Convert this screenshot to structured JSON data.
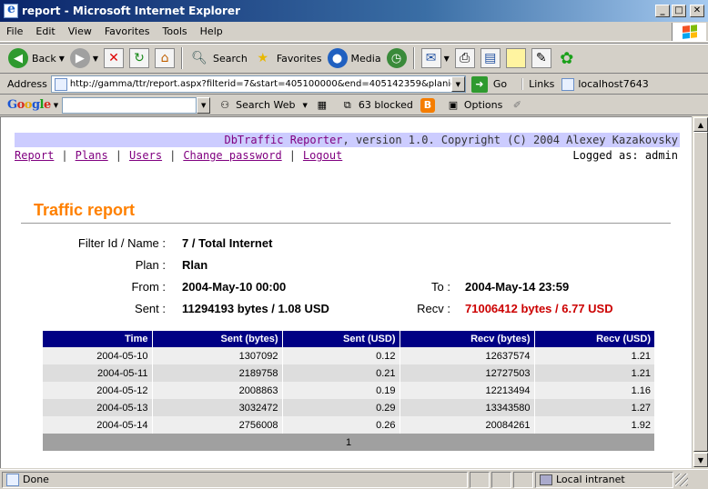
{
  "window": {
    "title": "report - Microsoft Internet Explorer",
    "min": "_",
    "max": "□",
    "close": "✕"
  },
  "menu": [
    "File",
    "Edit",
    "View",
    "Favorites",
    "Tools",
    "Help"
  ],
  "toolbar": {
    "back": "Back",
    "search": "Search",
    "favorites": "Favorites",
    "media": "Media"
  },
  "address": {
    "label": "Address",
    "url": "http://gamma/ttr/report.aspx?filterid=7&start=405100000&end=405142359&planid=9",
    "go": "Go",
    "links_label": "Links",
    "link_item": "localhost7643"
  },
  "google": {
    "search_web": "Search Web",
    "blocked": "63 blocked",
    "options": "Options"
  },
  "page": {
    "brand": "DbTraffic Reporter",
    "header_rest": ", version 1.0. Copyright (C) 2004 Alexey Kazakovsky",
    "nav": {
      "report": "Report",
      "plans": "Plans",
      "users": "Users",
      "change_password": "Change password",
      "logout": "Logout",
      "sep": "|",
      "logged_as": "Logged as: admin"
    },
    "title": "Traffic report",
    "info": {
      "filter_label": "Filter Id / Name :",
      "filter_value": "7 / Total Internet",
      "plan_label": "Plan :",
      "plan_value": "Rlan",
      "from_label": "From :",
      "from_value": "2004-May-10 00:00",
      "to_label": "To :",
      "to_value": "2004-May-14 23:59",
      "sent_label": "Sent :",
      "sent_value": "11294193 bytes / 1.08 USD",
      "recv_label": "Recv :",
      "recv_value": "71006412 bytes / 6.77 USD"
    },
    "table": {
      "headers": [
        "Time",
        "Sent (bytes)",
        "Sent (USD)",
        "Recv (bytes)",
        "Recv (USD)"
      ],
      "rows": [
        [
          "2004-05-10",
          "1307092",
          "0.12",
          "12637574",
          "1.21"
        ],
        [
          "2004-05-11",
          "2189758",
          "0.21",
          "12727503",
          "1.21"
        ],
        [
          "2004-05-12",
          "2008863",
          "0.19",
          "12213494",
          "1.16"
        ],
        [
          "2004-05-13",
          "3032472",
          "0.29",
          "13343580",
          "1.27"
        ],
        [
          "2004-05-14",
          "2756008",
          "0.26",
          "20084261",
          "1.92"
        ]
      ],
      "pager": "1"
    }
  },
  "status": {
    "text": "Done",
    "zone": "Local intranet"
  },
  "colors": {
    "title_accent": "#ff8000",
    "header_band": "#ccccff",
    "table_header": "#000084",
    "recv_highlight": "#cc0000",
    "link": "#800080"
  }
}
